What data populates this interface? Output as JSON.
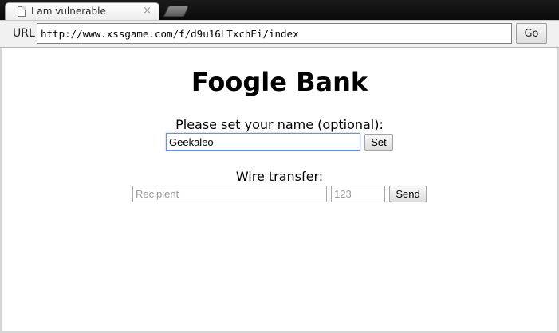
{
  "browser": {
    "tab": {
      "title": "I am vulnerable",
      "close_glyph": "×"
    },
    "url_label": "URL",
    "url_value": "http://www.xssgame.com/f/d9u16LTxchEi/index",
    "go_label": "Go"
  },
  "page": {
    "title": "Foogle Bank",
    "name_section": {
      "prompt": "Please set your name (optional):",
      "value": "Geekaleo",
      "set_label": "Set"
    },
    "wire_section": {
      "heading": "Wire transfer:",
      "recipient_placeholder": "Recipient",
      "amount_placeholder": "123",
      "send_label": "Send"
    }
  },
  "icons": {
    "tab_page": "page-icon",
    "tab_close": "close-icon"
  }
}
